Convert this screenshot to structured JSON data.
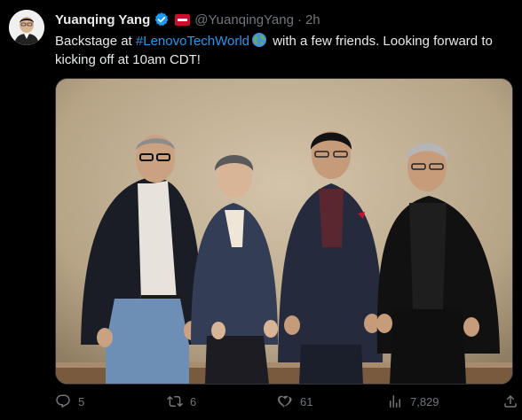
{
  "tweet": {
    "author_name": "Yuanqing Yang",
    "handle": "@YuanqingYang",
    "separator": "·",
    "time": "2h",
    "text_before": "Backstage at ",
    "hashtag": "#LenovoTechWorld",
    "text_after_line1": " with a few friends. Looking forward to kicking off at 10am CDT!"
  },
  "actions": {
    "replies": "5",
    "retweets": "6",
    "likes": "61",
    "views": "7,829"
  },
  "colors": {
    "background": "#000000",
    "text": "#e7e9ea",
    "muted": "#71767b",
    "link": "#1d9bf0",
    "verified": "#1d9bf0"
  },
  "icons": [
    "verified-badge-icon",
    "flag-icon",
    "globe-emoji-icon",
    "reply-icon",
    "retweet-icon",
    "like-icon",
    "views-icon",
    "share-icon"
  ]
}
